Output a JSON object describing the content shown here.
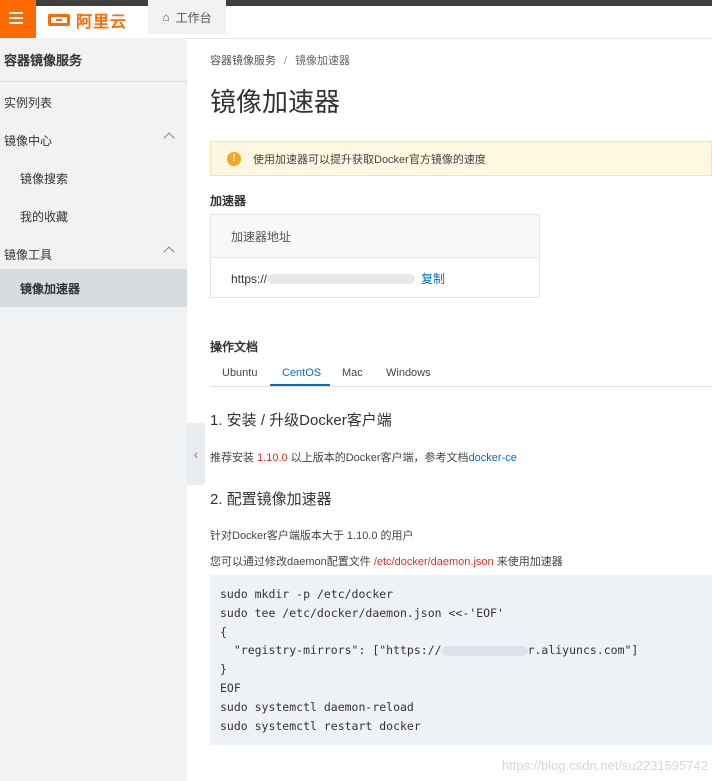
{
  "header": {
    "logo_text": "阿里云",
    "workbench_label": "工作台",
    "brand_color": "#ff6a00"
  },
  "sidebar": {
    "title": "容器镜像服务",
    "items": [
      {
        "label": "实例列表",
        "level": 1
      },
      {
        "label": "镜像中心",
        "level": 1,
        "expanded": true
      },
      {
        "label": "镜像搜索",
        "level": 2
      },
      {
        "label": "我的收藏",
        "level": 2
      },
      {
        "label": "镜像工具",
        "level": 1,
        "expanded": true
      },
      {
        "label": "镜像加速器",
        "level": 2,
        "active": true
      }
    ]
  },
  "breadcrumb": {
    "root": "容器镜像服务",
    "separator": "/",
    "current": "镜像加速器"
  },
  "page": {
    "title": "镜像加速器",
    "notice": "使用加速器可以提升获取Docker官方镜像的速度"
  },
  "accelerator": {
    "section_title": "加速器",
    "column_header": "加速器地址",
    "address_prefix": "https://",
    "copy_label": "复制"
  },
  "docs": {
    "section_title": "操作文档",
    "tabs": [
      "Ubuntu",
      "CentOS",
      "Mac",
      "Windows"
    ],
    "active_tab": "CentOS",
    "step1_title": "1. 安装 / 升级Docker客户端",
    "step1_text_a": "推荐安装 ",
    "step1_version": "1.10.0",
    "step1_text_b": " 以上版本的Docker客户端，参考文档",
    "step1_link": "docker-ce",
    "step2_title": "2. 配置镜像加速器",
    "step2_line1": "针对Docker客户端版本大于 1.10.0 的用户",
    "step2_line2_a": "您可以通过修改daemon配置文件 ",
    "step2_line2_path": "/etc/docker/daemon.json",
    "step2_line2_b": " 来使用加速器",
    "code": {
      "line1": "sudo mkdir -p /etc/docker",
      "line2": "sudo tee /etc/docker/daemon.json <<-'EOF'",
      "line3": "{",
      "line4_a": "  \"registry-mirrors\": [\"https://",
      "line4_b": "r.aliyuncs.com\"]",
      "line5": "}",
      "line6": "EOF",
      "line7": "sudo systemctl daemon-reload",
      "line8": "sudo systemctl restart docker"
    }
  },
  "watermark": "https://blog.csdn.net/su2231595742"
}
